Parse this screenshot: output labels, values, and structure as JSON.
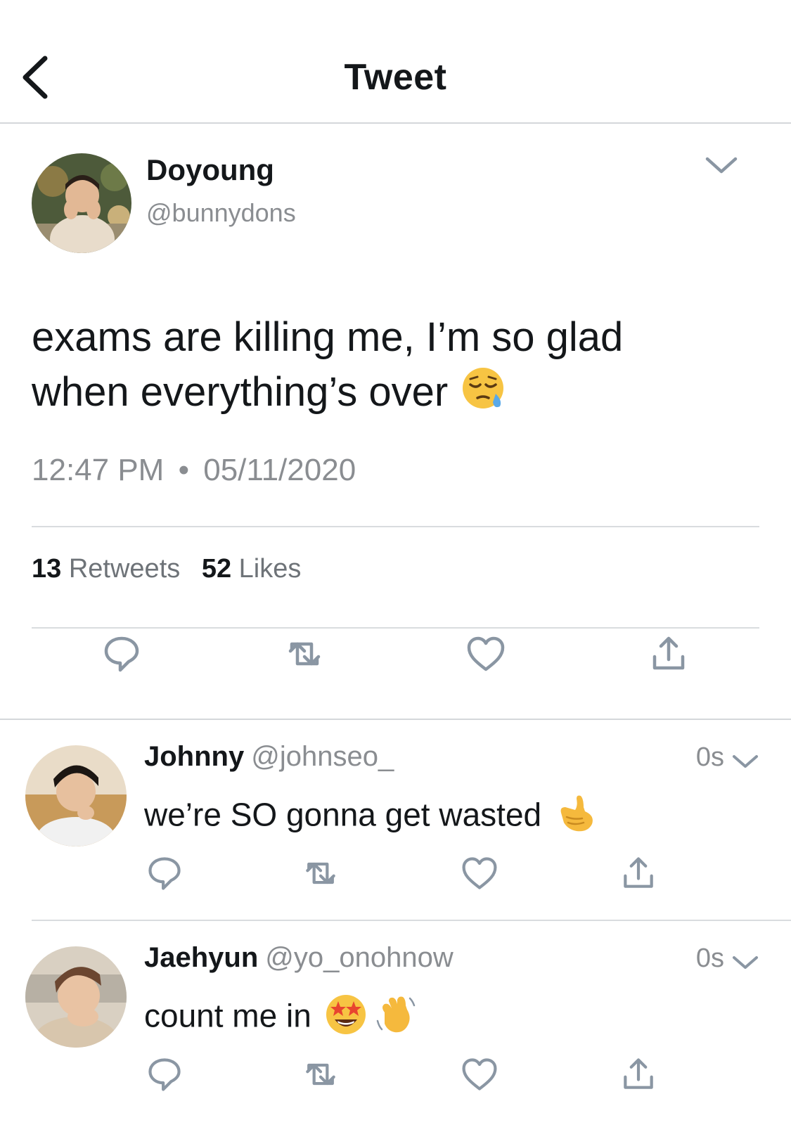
{
  "header": {
    "title": "Tweet"
  },
  "tweet": {
    "display_name": "Doyoung",
    "handle": "@bunnydons",
    "text_line1": "exams are killing me, I’m so glad",
    "text_line2": "when everything’s over",
    "emoji": "sleepy-face",
    "time": "12:47 PM",
    "separator": "•",
    "date": "05/11/2020",
    "retweets_count": "13",
    "retweets_label": "Retweets",
    "likes_count": "52",
    "likes_label": "Likes"
  },
  "replies": [
    {
      "display_name": "Johnny",
      "handle": "@johnseo_",
      "time": "0s",
      "text": "we’re SO gonna get wasted",
      "emojis": [
        "call-me-hand"
      ]
    },
    {
      "display_name": "Jaehyun",
      "handle": "@yo_onohnow",
      "time": "0s",
      "text": "count me in",
      "emojis": [
        "star-struck",
        "waving-hand"
      ]
    }
  ],
  "icons": [
    "back-arrow-icon",
    "chevron-down-icon",
    "reply-icon",
    "retweet-icon",
    "like-icon",
    "share-icon"
  ],
  "colors": {
    "text": "#14171a",
    "secondary": "#8a8d91",
    "icon": "#8a96a3",
    "divider": "#d4d7da"
  }
}
